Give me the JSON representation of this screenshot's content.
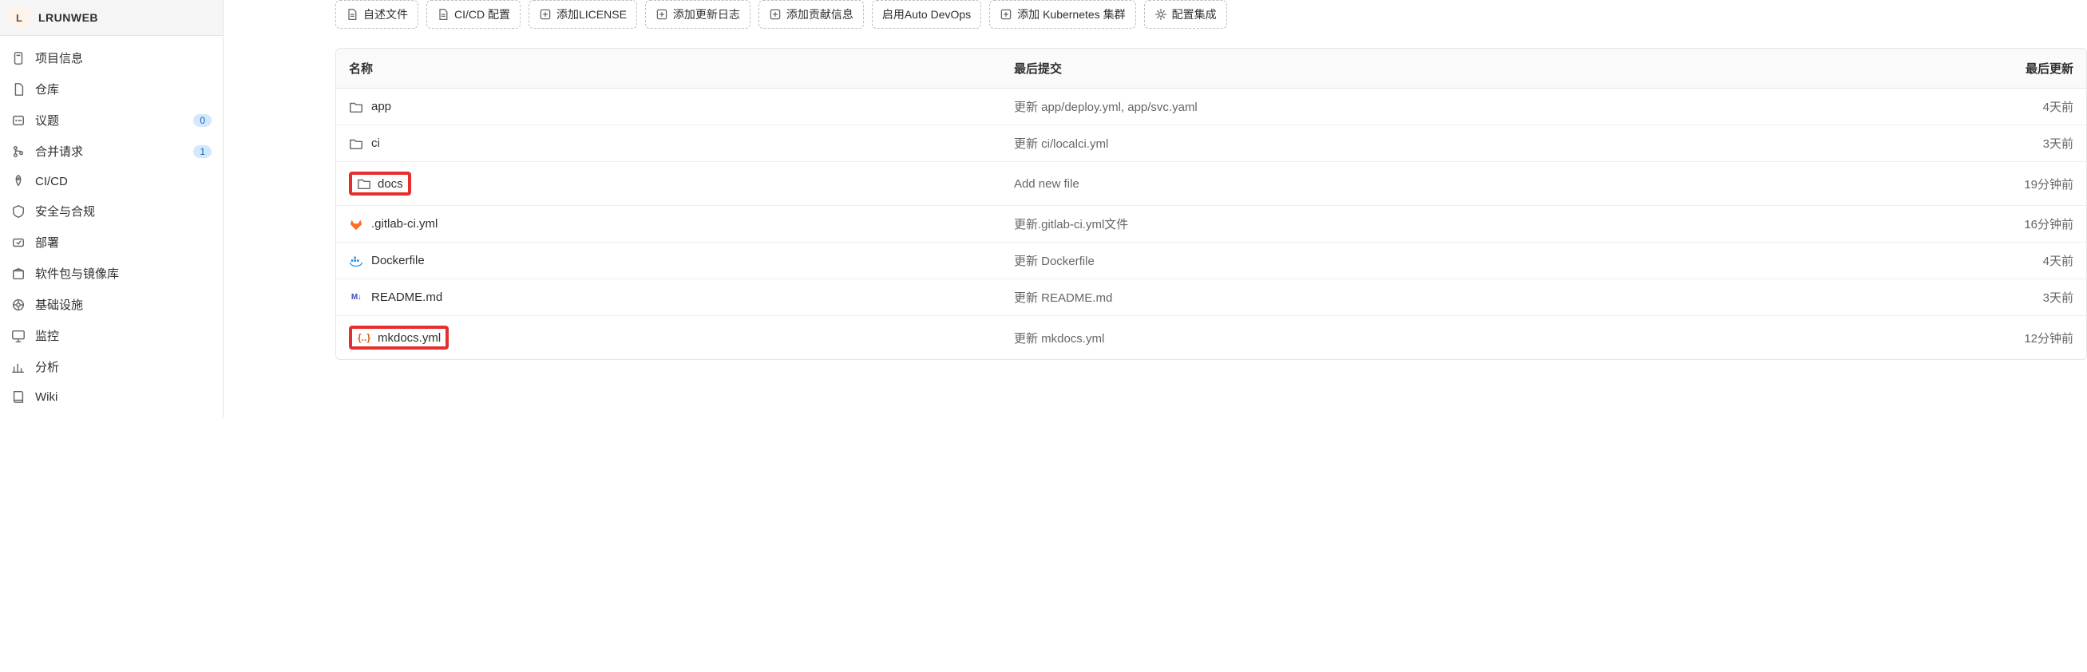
{
  "project": {
    "avatar_letter": "L",
    "name": "LRUNWEB"
  },
  "sidebar": {
    "items": [
      {
        "label": "项目信息",
        "icon": "info"
      },
      {
        "label": "仓库",
        "icon": "file"
      },
      {
        "label": "议题",
        "icon": "issues",
        "badge": "0"
      },
      {
        "label": "合并请求",
        "icon": "merge",
        "badge": "1"
      },
      {
        "label": "CI/CD",
        "icon": "rocket"
      },
      {
        "label": "安全与合规",
        "icon": "shield"
      },
      {
        "label": "部署",
        "icon": "deploy"
      },
      {
        "label": "软件包与镜像库",
        "icon": "package"
      },
      {
        "label": "基础设施",
        "icon": "infra"
      },
      {
        "label": "监控",
        "icon": "monitor"
      },
      {
        "label": "分析",
        "icon": "analytics"
      },
      {
        "label": "Wiki",
        "icon": "book"
      }
    ]
  },
  "quick_actions": [
    {
      "label": "自述文件",
      "icon": "file-doc"
    },
    {
      "label": "CI/CD 配置",
      "icon": "file-doc"
    },
    {
      "label": "添加LICENSE",
      "icon": "plus"
    },
    {
      "label": "添加更新日志",
      "icon": "plus"
    },
    {
      "label": "添加贡献信息",
      "icon": "plus"
    },
    {
      "label": "启用Auto DevOps",
      "icon": "none"
    },
    {
      "label": "添加 Kubernetes 集群",
      "icon": "plus"
    },
    {
      "label": "配置集成",
      "icon": "gear"
    }
  ],
  "table": {
    "columns": {
      "name": "名称",
      "commit": "最后提交",
      "updated": "最后更新"
    },
    "rows": [
      {
        "name": "app",
        "icon": "folder",
        "commit": "更新 app/deploy.yml, app/svc.yaml",
        "updated": "4天前",
        "highlight": false
      },
      {
        "name": "ci",
        "icon": "folder",
        "commit": "更新 ci/localci.yml",
        "updated": "3天前",
        "highlight": false
      },
      {
        "name": "docs",
        "icon": "folder",
        "commit": "Add new file",
        "updated": "19分钟前",
        "highlight": true
      },
      {
        "name": ".gitlab-ci.yml",
        "icon": "gitlab",
        "commit": "更新.gitlab-ci.yml文件",
        "updated": "16分钟前",
        "highlight": false
      },
      {
        "name": "Dockerfile",
        "icon": "docker",
        "commit": "更新 Dockerfile",
        "updated": "4天前",
        "highlight": false
      },
      {
        "name": "README.md",
        "icon": "markdown",
        "commit": "更新 README.md",
        "updated": "3天前",
        "highlight": false
      },
      {
        "name": "mkdocs.yml",
        "icon": "yaml",
        "commit": "更新 mkdocs.yml",
        "updated": "12分钟前",
        "highlight": true
      }
    ]
  }
}
